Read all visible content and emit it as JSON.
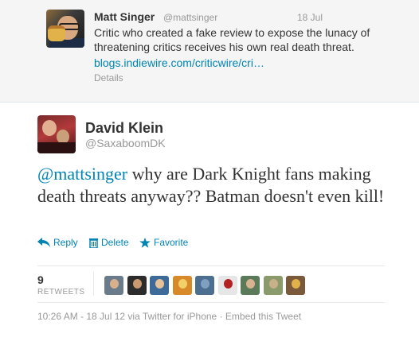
{
  "quoted_tweet": {
    "author_name": "Matt Singer",
    "author_handle": "@mattsinger",
    "date": "18 Jul",
    "text": "Critic who created a fake review to expose the lunacy of threatening critics receives his own real death threat.",
    "link": "blogs.indiewire.com/criticwire/cri…",
    "details_label": "Details"
  },
  "tweet": {
    "author_name": "David Klein",
    "author_handle": "@SaxaboomDK",
    "mention": "@mattsinger",
    "text_rest": " why are Dark Knight fans making death threats anyway?? Batman doesn't even kill!"
  },
  "actions": {
    "reply": "Reply",
    "delete": "Delete",
    "favorite": "Favorite"
  },
  "retweets": {
    "count": "9",
    "label": "RETWEETS",
    "avatars": [
      {
        "bg": "#6a7b8c",
        "face": "#d9b08c"
      },
      {
        "bg": "#2c2c2c",
        "face": "#c99a72"
      },
      {
        "bg": "#3e6a9a",
        "face": "#e6c29a"
      },
      {
        "bg": "#d88a2a",
        "face": "#f3d06a"
      },
      {
        "bg": "#4d6f8f",
        "face": "#7fa0c0"
      },
      {
        "bg": "#e6e6e6",
        "face": "#b22222"
      },
      {
        "bg": "#5a7a5a",
        "face": "#d7b38f"
      },
      {
        "bg": "#8a9a6a",
        "face": "#c7b08a"
      },
      {
        "bg": "#7a5a3a",
        "face": "#e2b24a"
      }
    ]
  },
  "meta": {
    "timestamp": "10:26 AM - 18 Jul 12 via Twitter for iPhone",
    "separator": "·",
    "embed": "Embed this Tweet"
  },
  "colors": {
    "link": "#0084b4",
    "muted": "#999999",
    "text": "#333333",
    "quoted_bg": "#f5f5f5"
  }
}
